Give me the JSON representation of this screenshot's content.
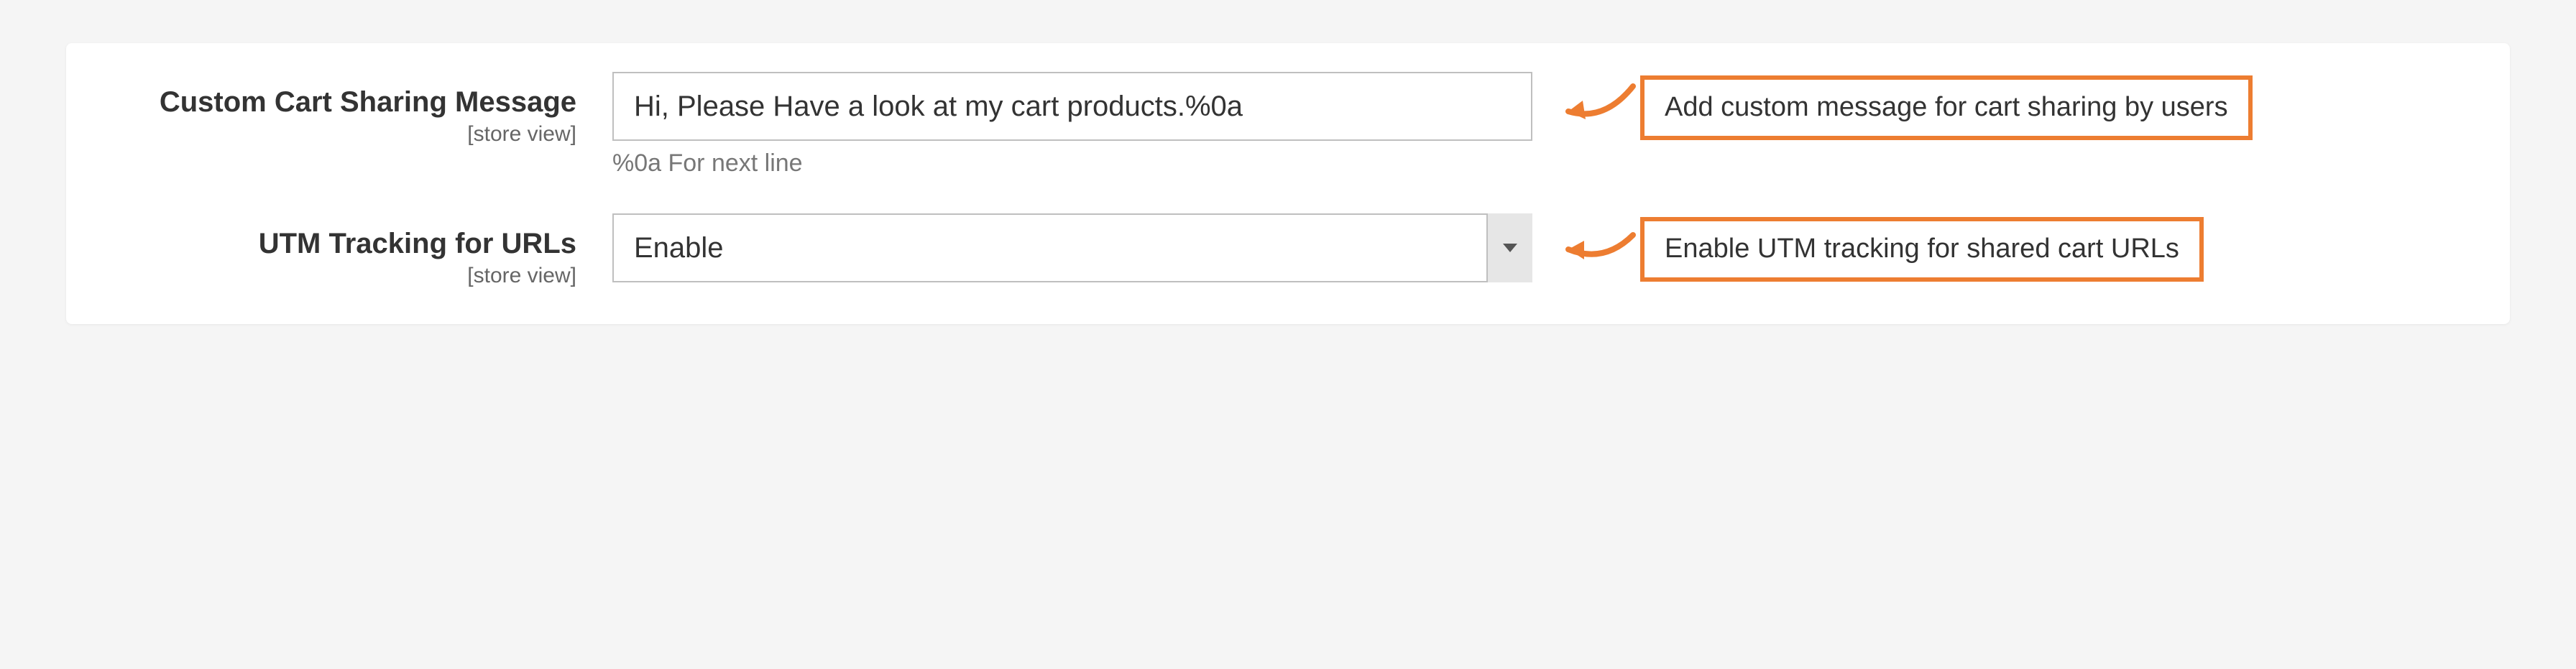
{
  "fields": {
    "customMessage": {
      "label": "Custom Cart Sharing Message",
      "scope": "[store view]",
      "value": "Hi, Please Have a look at my cart products.%0a",
      "hint": "%0a For next line",
      "annotation": "Add custom message for cart sharing by users"
    },
    "utmTracking": {
      "label": "UTM Tracking for URLs",
      "scope": "[store view]",
      "value": "Enable",
      "annotation": "Enable UTM tracking for shared cart URLs"
    }
  }
}
